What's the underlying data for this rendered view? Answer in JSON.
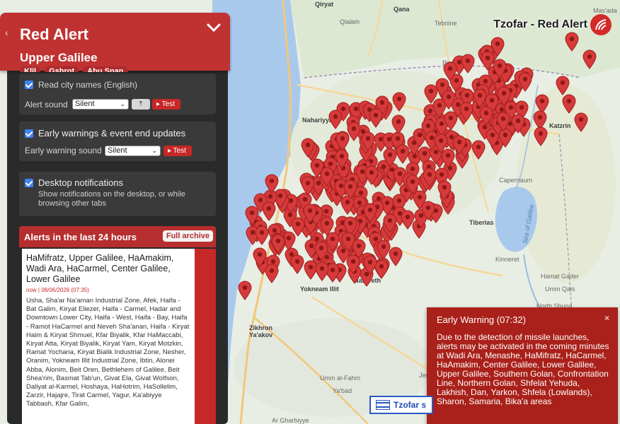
{
  "brand": {
    "title": "Tzofar - Red Alert",
    "logo_icon": "tzofar-logo-icon"
  },
  "sidebar": {
    "title": "Red Alert",
    "region": "Upper Galilee",
    "chips": [
      "Klil",
      "Gshrot",
      "Abu Snan"
    ],
    "settings": {
      "city_names": {
        "checked": true,
        "label": "Read city names (English)"
      },
      "alert_sound": {
        "label": "Alert sound",
        "value": "Silent",
        "test_label": "▸ Test"
      },
      "early_warnings": {
        "checked": true,
        "label": "Early warnings & event end updates"
      },
      "early_warning_sound": {
        "label": "Early warning sound",
        "value": "Silent",
        "test_label": "▸ Test"
      },
      "desktop_notifications": {
        "checked": true,
        "label": "Desktop notifications",
        "description": "Show notifications on the desktop, or while browsing other tabs"
      }
    },
    "alerts": {
      "heading": "Alerts in the last 24 hours",
      "archive_label": "Full archive",
      "latest": {
        "regions": "HaMifratz, Upper Galilee, HaAmakim, Wadi Ara, HaCarmel, Center Galilee, Lower Galilee",
        "time": "now | 08/06/2026 (07:35)",
        "cities": "Usha, Sha'ar Na'aman Industrial Zone, Afek, Haifa - Bat Galim, Kiryat Eliezer, Haifa - Carmel, Hadar and Downtown Lower City, Haifa - West, Haifa - Bay, Haifa - Ramot HaCarmel and Neveh Sha'anan, Haifa - Kiryat Haim & Kiryat Shmuel, Kfar Biyalik, Kfar HaMaccabi, Kiryat Atta, Kiryat Biyalik, Kiryat Yam, Kiryat Motzkin, Ramat Yochana, Kiryat Bialik Industrial Zone, Nesher, Oranim, Yokneam Illit Industrial Zone, Ibtin, Alonei Abba, Alonim, Beit Oren, Bethlehem of Galilee, Beit Shea'rim, Basmat Tab'un, Givat Ela, Givat Wolfson, Daliyat al-Karmel, Hoshaya, HaHotrim, HaSollelim, Zarzir, Hajajre, Tirat Carmel, Yagur, Ka'abiyye Tabbash, Kfar Galim,"
      }
    }
  },
  "early_warning": {
    "title": "Early Warning (07:32)",
    "close_icon": "×",
    "text": "Due to the detection of missile launches, alerts may be activated in the coming minutes at Wadi Ara, Menashe, HaMifratz, HaCarmel, HaAmakim, Center Galilee, Lower Galilee, Upper Galilee, Southern Golan, Confrontation Line, Northern Golan, Shfelat Yehuda, Lakhish, Dan, Yarkon, Shfela (Lowlands), Sharon, Samaria, Bika'a areas"
  },
  "bottom_bar": {
    "text": "Tzofar s"
  },
  "map": {
    "labels": [
      {
        "text": "Qiryat",
        "kind": "city"
      },
      {
        "text": "Qana",
        "kind": "city"
      },
      {
        "text": "Qlaileh",
        "kind": "plain"
      },
      {
        "text": "Tebnine",
        "kind": "plain"
      },
      {
        "text": "Mas'ada",
        "kind": "plain"
      },
      {
        "text": "Bint Jbeil",
        "kind": "plain"
      },
      {
        "text": "Nahariyya",
        "kind": "city"
      },
      {
        "text": "Katzrin",
        "kind": "city"
      },
      {
        "text": "Capernaum",
        "kind": "plain"
      },
      {
        "text": "Tiberias",
        "kind": "city"
      },
      {
        "text": "Sea of Galilee",
        "kind": "water"
      },
      {
        "text": "Kinneret",
        "kind": "plain"
      },
      {
        "text": "Hamat Gader",
        "kind": "plain"
      },
      {
        "text": "Umm Qais",
        "kind": "plain"
      },
      {
        "text": "Yokneam Illit",
        "kind": "city"
      },
      {
        "text": "Zikhron Ya'akov",
        "kind": "city"
      },
      {
        "text": "Nazareth",
        "kind": "city"
      },
      {
        "text": "North Shuna",
        "kind": "plain"
      },
      {
        "text": "Umm al-Fahm",
        "kind": "plain"
      },
      {
        "text": "Ya'bad",
        "kind": "plain"
      },
      {
        "text": "Jenin",
        "kind": "plain"
      },
      {
        "text": "Ar Gharbiyye",
        "kind": "plain"
      }
    ]
  }
}
